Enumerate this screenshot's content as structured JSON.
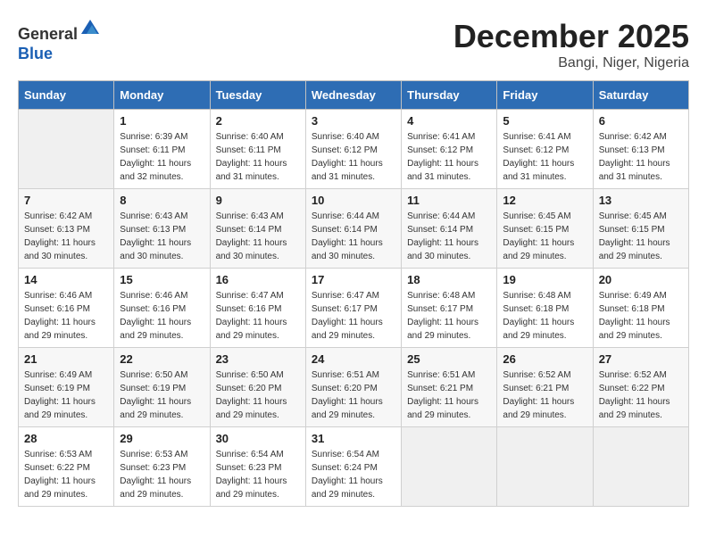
{
  "header": {
    "logo_line1": "General",
    "logo_line2": "Blue",
    "month": "December 2025",
    "location": "Bangi, Niger, Nigeria"
  },
  "days_of_week": [
    "Sunday",
    "Monday",
    "Tuesday",
    "Wednesday",
    "Thursday",
    "Friday",
    "Saturday"
  ],
  "weeks": [
    [
      {
        "day": "",
        "sunrise": "",
        "sunset": "",
        "daylight": ""
      },
      {
        "day": "1",
        "sunrise": "Sunrise: 6:39 AM",
        "sunset": "Sunset: 6:11 PM",
        "daylight": "Daylight: 11 hours and 32 minutes."
      },
      {
        "day": "2",
        "sunrise": "Sunrise: 6:40 AM",
        "sunset": "Sunset: 6:11 PM",
        "daylight": "Daylight: 11 hours and 31 minutes."
      },
      {
        "day": "3",
        "sunrise": "Sunrise: 6:40 AM",
        "sunset": "Sunset: 6:12 PM",
        "daylight": "Daylight: 11 hours and 31 minutes."
      },
      {
        "day": "4",
        "sunrise": "Sunrise: 6:41 AM",
        "sunset": "Sunset: 6:12 PM",
        "daylight": "Daylight: 11 hours and 31 minutes."
      },
      {
        "day": "5",
        "sunrise": "Sunrise: 6:41 AM",
        "sunset": "Sunset: 6:12 PM",
        "daylight": "Daylight: 11 hours and 31 minutes."
      },
      {
        "day": "6",
        "sunrise": "Sunrise: 6:42 AM",
        "sunset": "Sunset: 6:13 PM",
        "daylight": "Daylight: 11 hours and 31 minutes."
      }
    ],
    [
      {
        "day": "7",
        "sunrise": "Sunrise: 6:42 AM",
        "sunset": "Sunset: 6:13 PM",
        "daylight": "Daylight: 11 hours and 30 minutes."
      },
      {
        "day": "8",
        "sunrise": "Sunrise: 6:43 AM",
        "sunset": "Sunset: 6:13 PM",
        "daylight": "Daylight: 11 hours and 30 minutes."
      },
      {
        "day": "9",
        "sunrise": "Sunrise: 6:43 AM",
        "sunset": "Sunset: 6:14 PM",
        "daylight": "Daylight: 11 hours and 30 minutes."
      },
      {
        "day": "10",
        "sunrise": "Sunrise: 6:44 AM",
        "sunset": "Sunset: 6:14 PM",
        "daylight": "Daylight: 11 hours and 30 minutes."
      },
      {
        "day": "11",
        "sunrise": "Sunrise: 6:44 AM",
        "sunset": "Sunset: 6:14 PM",
        "daylight": "Daylight: 11 hours and 30 minutes."
      },
      {
        "day": "12",
        "sunrise": "Sunrise: 6:45 AM",
        "sunset": "Sunset: 6:15 PM",
        "daylight": "Daylight: 11 hours and 29 minutes."
      },
      {
        "day": "13",
        "sunrise": "Sunrise: 6:45 AM",
        "sunset": "Sunset: 6:15 PM",
        "daylight": "Daylight: 11 hours and 29 minutes."
      }
    ],
    [
      {
        "day": "14",
        "sunrise": "Sunrise: 6:46 AM",
        "sunset": "Sunset: 6:16 PM",
        "daylight": "Daylight: 11 hours and 29 minutes."
      },
      {
        "day": "15",
        "sunrise": "Sunrise: 6:46 AM",
        "sunset": "Sunset: 6:16 PM",
        "daylight": "Daylight: 11 hours and 29 minutes."
      },
      {
        "day": "16",
        "sunrise": "Sunrise: 6:47 AM",
        "sunset": "Sunset: 6:16 PM",
        "daylight": "Daylight: 11 hours and 29 minutes."
      },
      {
        "day": "17",
        "sunrise": "Sunrise: 6:47 AM",
        "sunset": "Sunset: 6:17 PM",
        "daylight": "Daylight: 11 hours and 29 minutes."
      },
      {
        "day": "18",
        "sunrise": "Sunrise: 6:48 AM",
        "sunset": "Sunset: 6:17 PM",
        "daylight": "Daylight: 11 hours and 29 minutes."
      },
      {
        "day": "19",
        "sunrise": "Sunrise: 6:48 AM",
        "sunset": "Sunset: 6:18 PM",
        "daylight": "Daylight: 11 hours and 29 minutes."
      },
      {
        "day": "20",
        "sunrise": "Sunrise: 6:49 AM",
        "sunset": "Sunset: 6:18 PM",
        "daylight": "Daylight: 11 hours and 29 minutes."
      }
    ],
    [
      {
        "day": "21",
        "sunrise": "Sunrise: 6:49 AM",
        "sunset": "Sunset: 6:19 PM",
        "daylight": "Daylight: 11 hours and 29 minutes."
      },
      {
        "day": "22",
        "sunrise": "Sunrise: 6:50 AM",
        "sunset": "Sunset: 6:19 PM",
        "daylight": "Daylight: 11 hours and 29 minutes."
      },
      {
        "day": "23",
        "sunrise": "Sunrise: 6:50 AM",
        "sunset": "Sunset: 6:20 PM",
        "daylight": "Daylight: 11 hours and 29 minutes."
      },
      {
        "day": "24",
        "sunrise": "Sunrise: 6:51 AM",
        "sunset": "Sunset: 6:20 PM",
        "daylight": "Daylight: 11 hours and 29 minutes."
      },
      {
        "day": "25",
        "sunrise": "Sunrise: 6:51 AM",
        "sunset": "Sunset: 6:21 PM",
        "daylight": "Daylight: 11 hours and 29 minutes."
      },
      {
        "day": "26",
        "sunrise": "Sunrise: 6:52 AM",
        "sunset": "Sunset: 6:21 PM",
        "daylight": "Daylight: 11 hours and 29 minutes."
      },
      {
        "day": "27",
        "sunrise": "Sunrise: 6:52 AM",
        "sunset": "Sunset: 6:22 PM",
        "daylight": "Daylight: 11 hours and 29 minutes."
      }
    ],
    [
      {
        "day": "28",
        "sunrise": "Sunrise: 6:53 AM",
        "sunset": "Sunset: 6:22 PM",
        "daylight": "Daylight: 11 hours and 29 minutes."
      },
      {
        "day": "29",
        "sunrise": "Sunrise: 6:53 AM",
        "sunset": "Sunset: 6:23 PM",
        "daylight": "Daylight: 11 hours and 29 minutes."
      },
      {
        "day": "30",
        "sunrise": "Sunrise: 6:54 AM",
        "sunset": "Sunset: 6:23 PM",
        "daylight": "Daylight: 11 hours and 29 minutes."
      },
      {
        "day": "31",
        "sunrise": "Sunrise: 6:54 AM",
        "sunset": "Sunset: 6:24 PM",
        "daylight": "Daylight: 11 hours and 29 minutes."
      },
      {
        "day": "",
        "sunrise": "",
        "sunset": "",
        "daylight": ""
      },
      {
        "day": "",
        "sunrise": "",
        "sunset": "",
        "daylight": ""
      },
      {
        "day": "",
        "sunrise": "",
        "sunset": "",
        "daylight": ""
      }
    ]
  ]
}
